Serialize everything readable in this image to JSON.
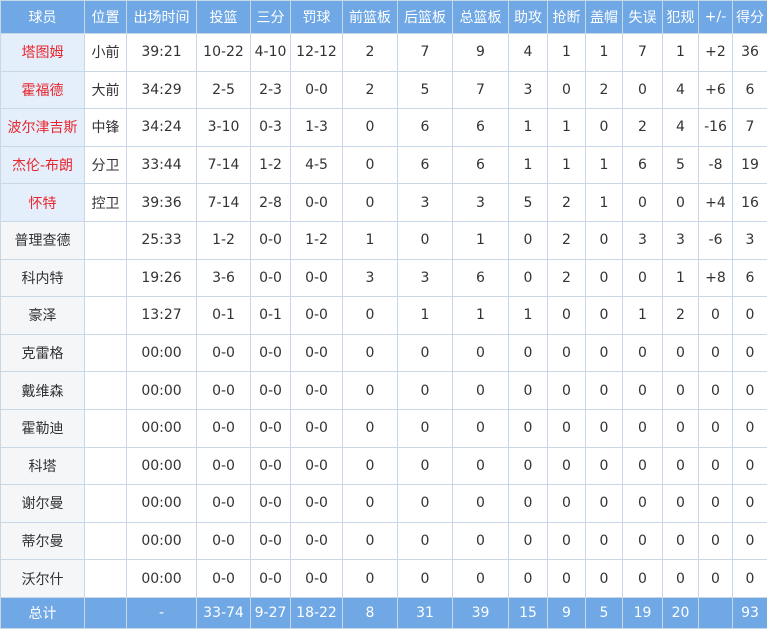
{
  "columns": [
    "球员",
    "位置",
    "出场时间",
    "投篮",
    "三分",
    "罚球",
    "前篮板",
    "后篮板",
    "总篮板",
    "助攻",
    "抢断",
    "盖帽",
    "失误",
    "犯规",
    "+/-",
    "得分"
  ],
  "players": [
    {
      "name": "塔图姆",
      "pos": "小前",
      "min": "39:21",
      "fg": "10-22",
      "tp": "4-10",
      "ft": "12-12",
      "oreb": "2",
      "dreb": "7",
      "reb": "9",
      "ast": "4",
      "stl": "1",
      "blk": "1",
      "tov": "7",
      "pf": "1",
      "pm": "+2",
      "pts": "36"
    },
    {
      "name": "霍福德",
      "pos": "大前",
      "min": "34:29",
      "fg": "2-5",
      "tp": "2-3",
      "ft": "0-0",
      "oreb": "2",
      "dreb": "5",
      "reb": "7",
      "ast": "3",
      "stl": "0",
      "blk": "2",
      "tov": "0",
      "pf": "4",
      "pm": "+6",
      "pts": "6"
    },
    {
      "name": "波尔津吉斯",
      "pos": "中锋",
      "min": "34:24",
      "fg": "3-10",
      "tp": "0-3",
      "ft": "1-3",
      "oreb": "0",
      "dreb": "6",
      "reb": "6",
      "ast": "1",
      "stl": "1",
      "blk": "0",
      "tov": "2",
      "pf": "4",
      "pm": "-16",
      "pts": "7"
    },
    {
      "name": "杰伦-布朗",
      "pos": "分卫",
      "min": "33:44",
      "fg": "7-14",
      "tp": "1-2",
      "ft": "4-5",
      "oreb": "0",
      "dreb": "6",
      "reb": "6",
      "ast": "1",
      "stl": "1",
      "blk": "1",
      "tov": "6",
      "pf": "5",
      "pm": "-8",
      "pts": "19"
    },
    {
      "name": "怀特",
      "pos": "控卫",
      "min": "39:36",
      "fg": "7-14",
      "tp": "2-8",
      "ft": "0-0",
      "oreb": "0",
      "dreb": "3",
      "reb": "3",
      "ast": "5",
      "stl": "2",
      "blk": "1",
      "tov": "0",
      "pf": "0",
      "pm": "+4",
      "pts": "16"
    },
    {
      "name": "普理查德",
      "pos": "",
      "min": "25:33",
      "fg": "1-2",
      "tp": "0-0",
      "ft": "1-2",
      "oreb": "1",
      "dreb": "0",
      "reb": "1",
      "ast": "0",
      "stl": "2",
      "blk": "0",
      "tov": "3",
      "pf": "3",
      "pm": "-6",
      "pts": "3"
    },
    {
      "name": "科内特",
      "pos": "",
      "min": "19:26",
      "fg": "3-6",
      "tp": "0-0",
      "ft": "0-0",
      "oreb": "3",
      "dreb": "3",
      "reb": "6",
      "ast": "0",
      "stl": "2",
      "blk": "0",
      "tov": "0",
      "pf": "1",
      "pm": "+8",
      "pts": "6"
    },
    {
      "name": "豪泽",
      "pos": "",
      "min": "13:27",
      "fg": "0-1",
      "tp": "0-1",
      "ft": "0-0",
      "oreb": "0",
      "dreb": "1",
      "reb": "1",
      "ast": "1",
      "stl": "0",
      "blk": "0",
      "tov": "1",
      "pf": "2",
      "pm": "0",
      "pts": "0"
    },
    {
      "name": "克雷格",
      "pos": "",
      "min": "00:00",
      "fg": "0-0",
      "tp": "0-0",
      "ft": "0-0",
      "oreb": "0",
      "dreb": "0",
      "reb": "0",
      "ast": "0",
      "stl": "0",
      "blk": "0",
      "tov": "0",
      "pf": "0",
      "pm": "0",
      "pts": "0"
    },
    {
      "name": "戴维森",
      "pos": "",
      "min": "00:00",
      "fg": "0-0",
      "tp": "0-0",
      "ft": "0-0",
      "oreb": "0",
      "dreb": "0",
      "reb": "0",
      "ast": "0",
      "stl": "0",
      "blk": "0",
      "tov": "0",
      "pf": "0",
      "pm": "0",
      "pts": "0"
    },
    {
      "name": "霍勒迪",
      "pos": "",
      "min": "00:00",
      "fg": "0-0",
      "tp": "0-0",
      "ft": "0-0",
      "oreb": "0",
      "dreb": "0",
      "reb": "0",
      "ast": "0",
      "stl": "0",
      "blk": "0",
      "tov": "0",
      "pf": "0",
      "pm": "0",
      "pts": "0"
    },
    {
      "name": "科塔",
      "pos": "",
      "min": "00:00",
      "fg": "0-0",
      "tp": "0-0",
      "ft": "0-0",
      "oreb": "0",
      "dreb": "0",
      "reb": "0",
      "ast": "0",
      "stl": "0",
      "blk": "0",
      "tov": "0",
      "pf": "0",
      "pm": "0",
      "pts": "0"
    },
    {
      "name": "谢尔曼",
      "pos": "",
      "min": "00:00",
      "fg": "0-0",
      "tp": "0-0",
      "ft": "0-0",
      "oreb": "0",
      "dreb": "0",
      "reb": "0",
      "ast": "0",
      "stl": "0",
      "blk": "0",
      "tov": "0",
      "pf": "0",
      "pm": "0",
      "pts": "0"
    },
    {
      "name": "蒂尔曼",
      "pos": "",
      "min": "00:00",
      "fg": "0-0",
      "tp": "0-0",
      "ft": "0-0",
      "oreb": "0",
      "dreb": "0",
      "reb": "0",
      "ast": "0",
      "stl": "0",
      "blk": "0",
      "tov": "0",
      "pf": "0",
      "pm": "0",
      "pts": "0"
    },
    {
      "name": "沃尔什",
      "pos": "",
      "min": "00:00",
      "fg": "0-0",
      "tp": "0-0",
      "ft": "0-0",
      "oreb": "0",
      "dreb": "0",
      "reb": "0",
      "ast": "0",
      "stl": "0",
      "blk": "0",
      "tov": "0",
      "pf": "0",
      "pm": "0",
      "pts": "0"
    }
  ],
  "totals": {
    "name": "总计",
    "pos": "",
    "min": "-",
    "fg": "33-74",
    "tp": "9-27",
    "ft": "18-22",
    "oreb": "8",
    "dreb": "31",
    "reb": "39",
    "ast": "15",
    "stl": "9",
    "blk": "5",
    "tov": "19",
    "pf": "20",
    "pm": "",
    "pts": "93"
  },
  "colors": {
    "header_bg": "#6fa8e5",
    "starter_name_bg": "#e4effb",
    "starter_name_text": "#e8262d",
    "border": "#c9d8e6"
  }
}
